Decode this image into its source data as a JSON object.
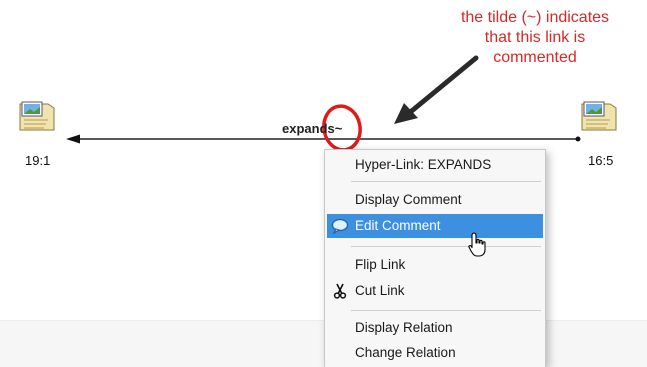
{
  "annotation": {
    "lines": [
      "the tilde (~) indicates",
      "that this link is",
      "commented"
    ],
    "color": "#d12a2a"
  },
  "diagram": {
    "left_node": {
      "label": "19:1"
    },
    "right_node": {
      "label": "16:5"
    },
    "link_label": "expands~"
  },
  "context_menu": {
    "header": "Hyper-Link: EXPANDS",
    "items": [
      {
        "label": "Display Comment",
        "icon": ""
      },
      {
        "label": "Edit Comment",
        "icon": "speech-bubble-icon",
        "highlighted": true
      },
      {
        "label": "Flip Link",
        "icon": ""
      },
      {
        "label": "Cut Link",
        "icon": "scissors-icon"
      },
      {
        "label": "Display Relation",
        "icon": ""
      },
      {
        "label": "Change Relation",
        "icon": ""
      }
    ],
    "highlight_color": "#3d8fe0"
  }
}
